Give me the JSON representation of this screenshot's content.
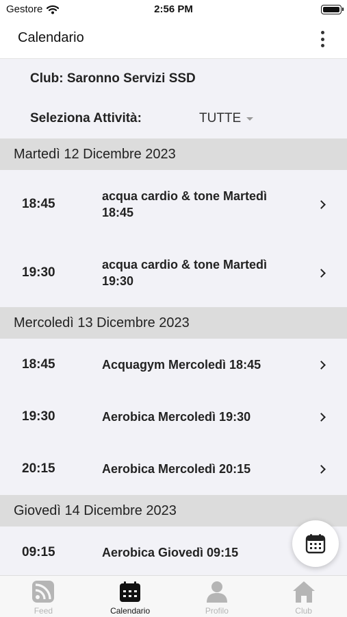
{
  "status_bar": {
    "carrier": "Gestore",
    "time": "2:56 PM"
  },
  "app_bar": {
    "title": "Calendario",
    "menu_icon": "more-vertical-icon"
  },
  "club": {
    "label": "Club: Saronno Servizi SSD"
  },
  "filter": {
    "label": "Seleziona Attività:",
    "value": "TUTTE"
  },
  "days": [
    {
      "header": "Martedì 12 Dicembre 2023",
      "sessions": [
        {
          "time": "18:45",
          "name": "acqua cardio & tone Martedì 18:45"
        },
        {
          "time": "19:30",
          "name": "acqua cardio & tone Martedì 19:30"
        }
      ]
    },
    {
      "header": "Mercoledì 13 Dicembre 2023",
      "sessions": [
        {
          "time": "18:45",
          "name": "Acquagym Mercoledì 18:45"
        },
        {
          "time": "19:30",
          "name": "Aerobica Mercoledì 19:30"
        },
        {
          "time": "20:15",
          "name": "Aerobica Mercoledì 20:15"
        }
      ]
    },
    {
      "header": "Giovedì 14 Dicembre 2023",
      "sessions": [
        {
          "time": "09:15",
          "name": "Aerobica Giovedì 09:15"
        }
      ]
    }
  ],
  "tabs": [
    {
      "label": "Feed",
      "icon": "rss-feed-icon",
      "active": false
    },
    {
      "label": "Calendario",
      "icon": "calendar-icon",
      "active": true
    },
    {
      "label": "Profilo",
      "icon": "person-icon",
      "active": false
    },
    {
      "label": "Club",
      "icon": "home-icon",
      "active": false
    }
  ],
  "colors": {
    "active_tab": "#111111",
    "inactive_tab": "#b5b5b5",
    "section_header_bg": "#dcdcdc",
    "background": "#f2f2f7"
  }
}
